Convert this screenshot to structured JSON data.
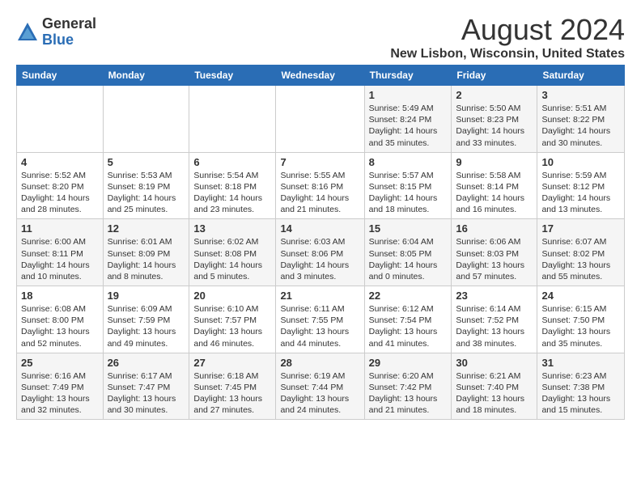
{
  "logo": {
    "general": "General",
    "blue": "Blue"
  },
  "title": "August 2024",
  "location": "New Lisbon, Wisconsin, United States",
  "weekdays": [
    "Sunday",
    "Monday",
    "Tuesday",
    "Wednesday",
    "Thursday",
    "Friday",
    "Saturday"
  ],
  "weeks": [
    [
      {
        "day": "",
        "content": ""
      },
      {
        "day": "",
        "content": ""
      },
      {
        "day": "",
        "content": ""
      },
      {
        "day": "",
        "content": ""
      },
      {
        "day": "1",
        "content": "Sunrise: 5:49 AM\nSunset: 8:24 PM\nDaylight: 14 hours\nand 35 minutes."
      },
      {
        "day": "2",
        "content": "Sunrise: 5:50 AM\nSunset: 8:23 PM\nDaylight: 14 hours\nand 33 minutes."
      },
      {
        "day": "3",
        "content": "Sunrise: 5:51 AM\nSunset: 8:22 PM\nDaylight: 14 hours\nand 30 minutes."
      }
    ],
    [
      {
        "day": "4",
        "content": "Sunrise: 5:52 AM\nSunset: 8:20 PM\nDaylight: 14 hours\nand 28 minutes."
      },
      {
        "day": "5",
        "content": "Sunrise: 5:53 AM\nSunset: 8:19 PM\nDaylight: 14 hours\nand 25 minutes."
      },
      {
        "day": "6",
        "content": "Sunrise: 5:54 AM\nSunset: 8:18 PM\nDaylight: 14 hours\nand 23 minutes."
      },
      {
        "day": "7",
        "content": "Sunrise: 5:55 AM\nSunset: 8:16 PM\nDaylight: 14 hours\nand 21 minutes."
      },
      {
        "day": "8",
        "content": "Sunrise: 5:57 AM\nSunset: 8:15 PM\nDaylight: 14 hours\nand 18 minutes."
      },
      {
        "day": "9",
        "content": "Sunrise: 5:58 AM\nSunset: 8:14 PM\nDaylight: 14 hours\nand 16 minutes."
      },
      {
        "day": "10",
        "content": "Sunrise: 5:59 AM\nSunset: 8:12 PM\nDaylight: 14 hours\nand 13 minutes."
      }
    ],
    [
      {
        "day": "11",
        "content": "Sunrise: 6:00 AM\nSunset: 8:11 PM\nDaylight: 14 hours\nand 10 minutes."
      },
      {
        "day": "12",
        "content": "Sunrise: 6:01 AM\nSunset: 8:09 PM\nDaylight: 14 hours\nand 8 minutes."
      },
      {
        "day": "13",
        "content": "Sunrise: 6:02 AM\nSunset: 8:08 PM\nDaylight: 14 hours\nand 5 minutes."
      },
      {
        "day": "14",
        "content": "Sunrise: 6:03 AM\nSunset: 8:06 PM\nDaylight: 14 hours\nand 3 minutes."
      },
      {
        "day": "15",
        "content": "Sunrise: 6:04 AM\nSunset: 8:05 PM\nDaylight: 14 hours\nand 0 minutes."
      },
      {
        "day": "16",
        "content": "Sunrise: 6:06 AM\nSunset: 8:03 PM\nDaylight: 13 hours\nand 57 minutes."
      },
      {
        "day": "17",
        "content": "Sunrise: 6:07 AM\nSunset: 8:02 PM\nDaylight: 13 hours\nand 55 minutes."
      }
    ],
    [
      {
        "day": "18",
        "content": "Sunrise: 6:08 AM\nSunset: 8:00 PM\nDaylight: 13 hours\nand 52 minutes."
      },
      {
        "day": "19",
        "content": "Sunrise: 6:09 AM\nSunset: 7:59 PM\nDaylight: 13 hours\nand 49 minutes."
      },
      {
        "day": "20",
        "content": "Sunrise: 6:10 AM\nSunset: 7:57 PM\nDaylight: 13 hours\nand 46 minutes."
      },
      {
        "day": "21",
        "content": "Sunrise: 6:11 AM\nSunset: 7:55 PM\nDaylight: 13 hours\nand 44 minutes."
      },
      {
        "day": "22",
        "content": "Sunrise: 6:12 AM\nSunset: 7:54 PM\nDaylight: 13 hours\nand 41 minutes."
      },
      {
        "day": "23",
        "content": "Sunrise: 6:14 AM\nSunset: 7:52 PM\nDaylight: 13 hours\nand 38 minutes."
      },
      {
        "day": "24",
        "content": "Sunrise: 6:15 AM\nSunset: 7:50 PM\nDaylight: 13 hours\nand 35 minutes."
      }
    ],
    [
      {
        "day": "25",
        "content": "Sunrise: 6:16 AM\nSunset: 7:49 PM\nDaylight: 13 hours\nand 32 minutes."
      },
      {
        "day": "26",
        "content": "Sunrise: 6:17 AM\nSunset: 7:47 PM\nDaylight: 13 hours\nand 30 minutes."
      },
      {
        "day": "27",
        "content": "Sunrise: 6:18 AM\nSunset: 7:45 PM\nDaylight: 13 hours\nand 27 minutes."
      },
      {
        "day": "28",
        "content": "Sunrise: 6:19 AM\nSunset: 7:44 PM\nDaylight: 13 hours\nand 24 minutes."
      },
      {
        "day": "29",
        "content": "Sunrise: 6:20 AM\nSunset: 7:42 PM\nDaylight: 13 hours\nand 21 minutes."
      },
      {
        "day": "30",
        "content": "Sunrise: 6:21 AM\nSunset: 7:40 PM\nDaylight: 13 hours\nand 18 minutes."
      },
      {
        "day": "31",
        "content": "Sunrise: 6:23 AM\nSunset: 7:38 PM\nDaylight: 13 hours\nand 15 minutes."
      }
    ]
  ]
}
